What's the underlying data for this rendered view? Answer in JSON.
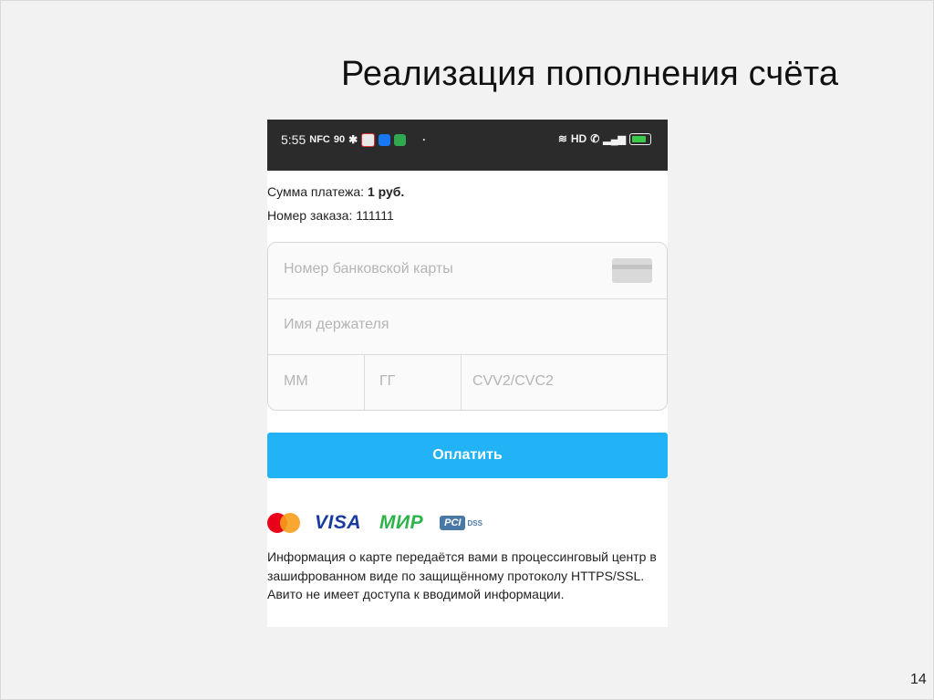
{
  "slide": {
    "title": "Реализация пополнения счёта",
    "page_number": "14"
  },
  "status_bar": {
    "time": "5:55",
    "nfc": "NFC",
    "speed": "90",
    "right_label": "HD"
  },
  "payment": {
    "sum_label": "Сумма платежа:",
    "sum_value": "1 руб.",
    "order_label": "Номер заказа:",
    "order_value": "111111"
  },
  "form": {
    "card_number_placeholder": "Номер банковской карты",
    "holder_placeholder": "Имя держателя",
    "month_placeholder": "ММ",
    "year_placeholder": "ГГ",
    "cvv_placeholder": "CVV2/CVC2"
  },
  "pay_button_label": "Оплатить",
  "logos": {
    "visa": "VISA",
    "mir": "МИР",
    "pci": "PCI",
    "dss": "DSS"
  },
  "info_text": "Информация о карте передаётся вами в процессинговый центр в зашифрованном виде по защищённому протоколу HTTPS/SSL. Авито не имеет доступа к вводимой информации.",
  "colors": {
    "accent": "#21b3f5",
    "status_bar": "#2b2b2b",
    "battery": "#3cc84a"
  }
}
